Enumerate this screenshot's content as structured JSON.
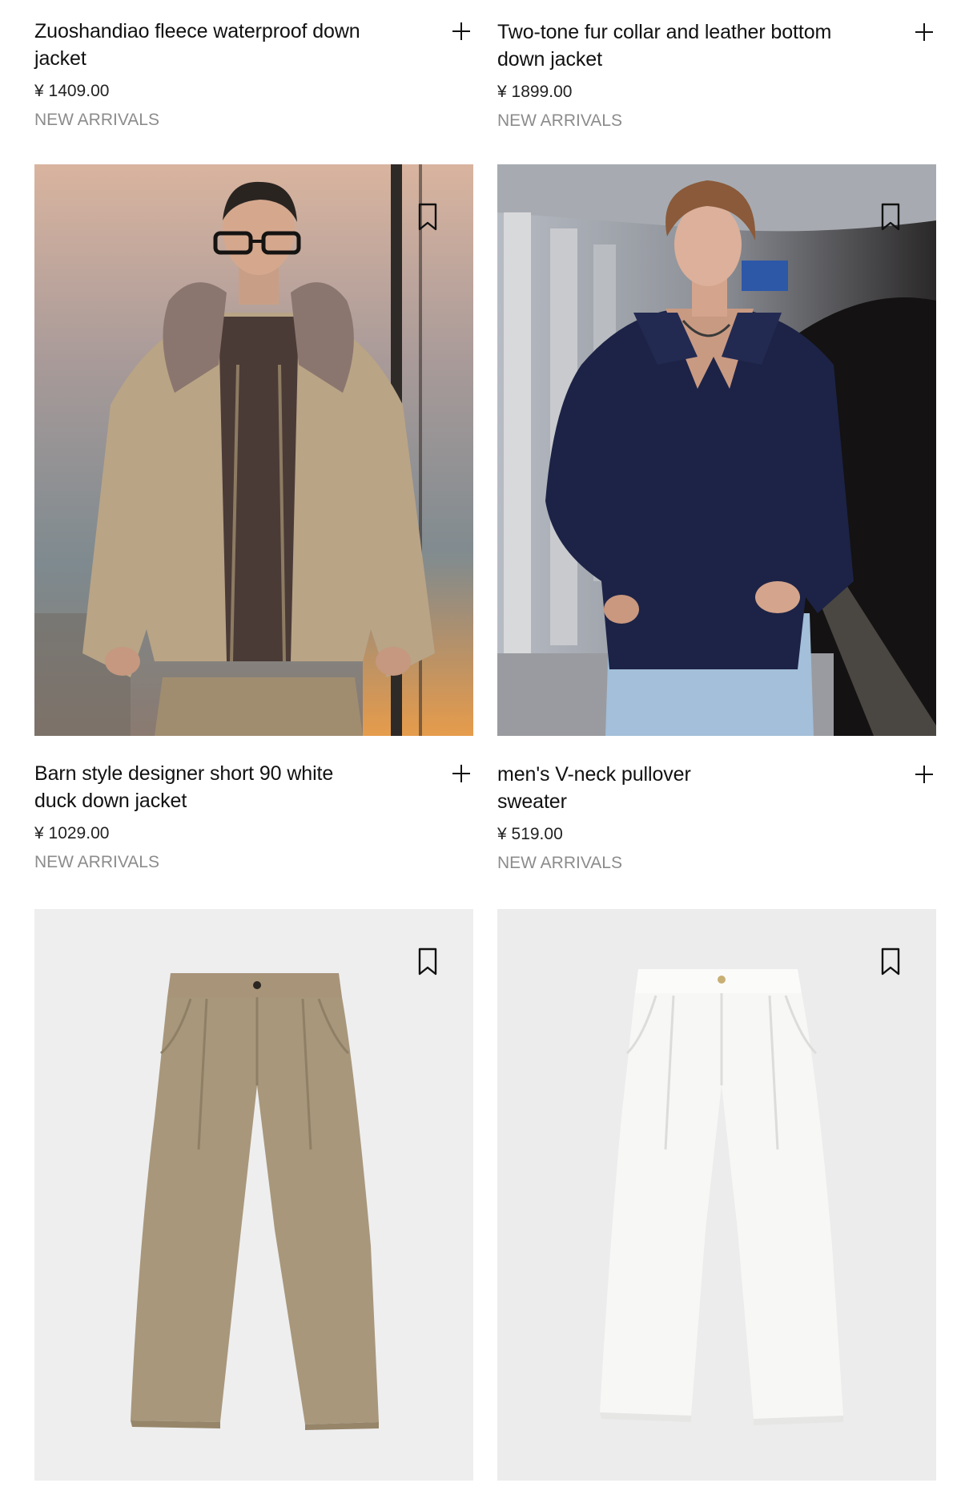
{
  "products": [
    {
      "name": "Zuoshandiao fleece waterproof down jacket",
      "price": "¥ 1409.00",
      "tag": "NEW ARRIVALS"
    },
    {
      "name": "Two-tone fur collar and leather bottom down jacket",
      "price": "¥ 1899.00",
      "tag": "NEW ARRIVALS"
    },
    {
      "name": "Barn style designer short 90 white duck down jacket",
      "price": "¥ 1029.00",
      "tag": "NEW ARRIVALS"
    },
    {
      "name": "men's V-neck pullover sweater",
      "price": "¥ 519.00",
      "tag": "NEW ARRIVALS"
    }
  ],
  "icons": {
    "add": "plus-icon",
    "save": "bookmark-icon"
  },
  "colors": {
    "text": "#111111",
    "tag": "#8c8c8c",
    "khaki_jacket": "#b9a486",
    "navy_sweater": "#1c2346",
    "khaki_pants": "#a8977b",
    "white_pants": "#f7f7f5"
  }
}
